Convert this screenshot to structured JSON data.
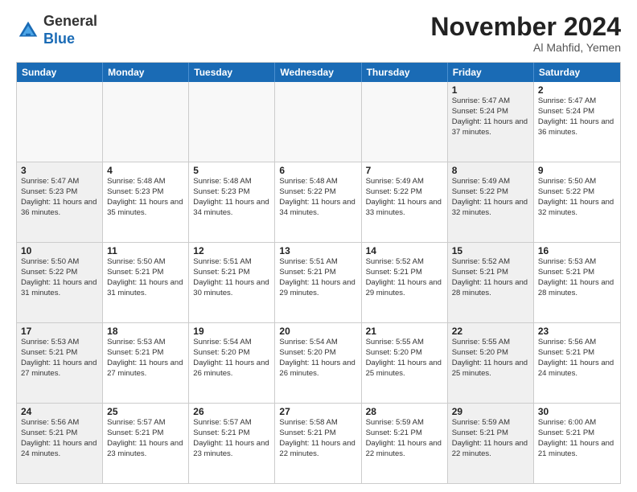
{
  "header": {
    "logo_general": "General",
    "logo_blue": "Blue",
    "month_title": "November 2024",
    "location": "Al Mahfid, Yemen"
  },
  "weekdays": [
    "Sunday",
    "Monday",
    "Tuesday",
    "Wednesday",
    "Thursday",
    "Friday",
    "Saturday"
  ],
  "weeks": [
    [
      {
        "day": "",
        "empty": true
      },
      {
        "day": "",
        "empty": true
      },
      {
        "day": "",
        "empty": true
      },
      {
        "day": "",
        "empty": true
      },
      {
        "day": "",
        "empty": true
      },
      {
        "day": "1",
        "sunrise": "Sunrise: 5:47 AM",
        "sunset": "Sunset: 5:24 PM",
        "daylight": "Daylight: 11 hours and 37 minutes.",
        "shaded": true
      },
      {
        "day": "2",
        "sunrise": "Sunrise: 5:47 AM",
        "sunset": "Sunset: 5:24 PM",
        "daylight": "Daylight: 11 hours and 36 minutes.",
        "shaded": false
      }
    ],
    [
      {
        "day": "3",
        "sunrise": "Sunrise: 5:47 AM",
        "sunset": "Sunset: 5:23 PM",
        "daylight": "Daylight: 11 hours and 36 minutes.",
        "shaded": true
      },
      {
        "day": "4",
        "sunrise": "Sunrise: 5:48 AM",
        "sunset": "Sunset: 5:23 PM",
        "daylight": "Daylight: 11 hours and 35 minutes.",
        "shaded": false
      },
      {
        "day": "5",
        "sunrise": "Sunrise: 5:48 AM",
        "sunset": "Sunset: 5:23 PM",
        "daylight": "Daylight: 11 hours and 34 minutes.",
        "shaded": false
      },
      {
        "day": "6",
        "sunrise": "Sunrise: 5:48 AM",
        "sunset": "Sunset: 5:22 PM",
        "daylight": "Daylight: 11 hours and 34 minutes.",
        "shaded": false
      },
      {
        "day": "7",
        "sunrise": "Sunrise: 5:49 AM",
        "sunset": "Sunset: 5:22 PM",
        "daylight": "Daylight: 11 hours and 33 minutes.",
        "shaded": false
      },
      {
        "day": "8",
        "sunrise": "Sunrise: 5:49 AM",
        "sunset": "Sunset: 5:22 PM",
        "daylight": "Daylight: 11 hours and 32 minutes.",
        "shaded": true
      },
      {
        "day": "9",
        "sunrise": "Sunrise: 5:50 AM",
        "sunset": "Sunset: 5:22 PM",
        "daylight": "Daylight: 11 hours and 32 minutes.",
        "shaded": false
      }
    ],
    [
      {
        "day": "10",
        "sunrise": "Sunrise: 5:50 AM",
        "sunset": "Sunset: 5:22 PM",
        "daylight": "Daylight: 11 hours and 31 minutes.",
        "shaded": true
      },
      {
        "day": "11",
        "sunrise": "Sunrise: 5:50 AM",
        "sunset": "Sunset: 5:21 PM",
        "daylight": "Daylight: 11 hours and 31 minutes.",
        "shaded": false
      },
      {
        "day": "12",
        "sunrise": "Sunrise: 5:51 AM",
        "sunset": "Sunset: 5:21 PM",
        "daylight": "Daylight: 11 hours and 30 minutes.",
        "shaded": false
      },
      {
        "day": "13",
        "sunrise": "Sunrise: 5:51 AM",
        "sunset": "Sunset: 5:21 PM",
        "daylight": "Daylight: 11 hours and 29 minutes.",
        "shaded": false
      },
      {
        "day": "14",
        "sunrise": "Sunrise: 5:52 AM",
        "sunset": "Sunset: 5:21 PM",
        "daylight": "Daylight: 11 hours and 29 minutes.",
        "shaded": false
      },
      {
        "day": "15",
        "sunrise": "Sunrise: 5:52 AM",
        "sunset": "Sunset: 5:21 PM",
        "daylight": "Daylight: 11 hours and 28 minutes.",
        "shaded": true
      },
      {
        "day": "16",
        "sunrise": "Sunrise: 5:53 AM",
        "sunset": "Sunset: 5:21 PM",
        "daylight": "Daylight: 11 hours and 28 minutes.",
        "shaded": false
      }
    ],
    [
      {
        "day": "17",
        "sunrise": "Sunrise: 5:53 AM",
        "sunset": "Sunset: 5:21 PM",
        "daylight": "Daylight: 11 hours and 27 minutes.",
        "shaded": true
      },
      {
        "day": "18",
        "sunrise": "Sunrise: 5:53 AM",
        "sunset": "Sunset: 5:21 PM",
        "daylight": "Daylight: 11 hours and 27 minutes.",
        "shaded": false
      },
      {
        "day": "19",
        "sunrise": "Sunrise: 5:54 AM",
        "sunset": "Sunset: 5:20 PM",
        "daylight": "Daylight: 11 hours and 26 minutes.",
        "shaded": false
      },
      {
        "day": "20",
        "sunrise": "Sunrise: 5:54 AM",
        "sunset": "Sunset: 5:20 PM",
        "daylight": "Daylight: 11 hours and 26 minutes.",
        "shaded": false
      },
      {
        "day": "21",
        "sunrise": "Sunrise: 5:55 AM",
        "sunset": "Sunset: 5:20 PM",
        "daylight": "Daylight: 11 hours and 25 minutes.",
        "shaded": false
      },
      {
        "day": "22",
        "sunrise": "Sunrise: 5:55 AM",
        "sunset": "Sunset: 5:20 PM",
        "daylight": "Daylight: 11 hours and 25 minutes.",
        "shaded": true
      },
      {
        "day": "23",
        "sunrise": "Sunrise: 5:56 AM",
        "sunset": "Sunset: 5:21 PM",
        "daylight": "Daylight: 11 hours and 24 minutes.",
        "shaded": false
      }
    ],
    [
      {
        "day": "24",
        "sunrise": "Sunrise: 5:56 AM",
        "sunset": "Sunset: 5:21 PM",
        "daylight": "Daylight: 11 hours and 24 minutes.",
        "shaded": true
      },
      {
        "day": "25",
        "sunrise": "Sunrise: 5:57 AM",
        "sunset": "Sunset: 5:21 PM",
        "daylight": "Daylight: 11 hours and 23 minutes.",
        "shaded": false
      },
      {
        "day": "26",
        "sunrise": "Sunrise: 5:57 AM",
        "sunset": "Sunset: 5:21 PM",
        "daylight": "Daylight: 11 hours and 23 minutes.",
        "shaded": false
      },
      {
        "day": "27",
        "sunrise": "Sunrise: 5:58 AM",
        "sunset": "Sunset: 5:21 PM",
        "daylight": "Daylight: 11 hours and 22 minutes.",
        "shaded": false
      },
      {
        "day": "28",
        "sunrise": "Sunrise: 5:59 AM",
        "sunset": "Sunset: 5:21 PM",
        "daylight": "Daylight: 11 hours and 22 minutes.",
        "shaded": false
      },
      {
        "day": "29",
        "sunrise": "Sunrise: 5:59 AM",
        "sunset": "Sunset: 5:21 PM",
        "daylight": "Daylight: 11 hours and 22 minutes.",
        "shaded": true
      },
      {
        "day": "30",
        "sunrise": "Sunrise: 6:00 AM",
        "sunset": "Sunset: 5:21 PM",
        "daylight": "Daylight: 11 hours and 21 minutes.",
        "shaded": false
      }
    ]
  ]
}
